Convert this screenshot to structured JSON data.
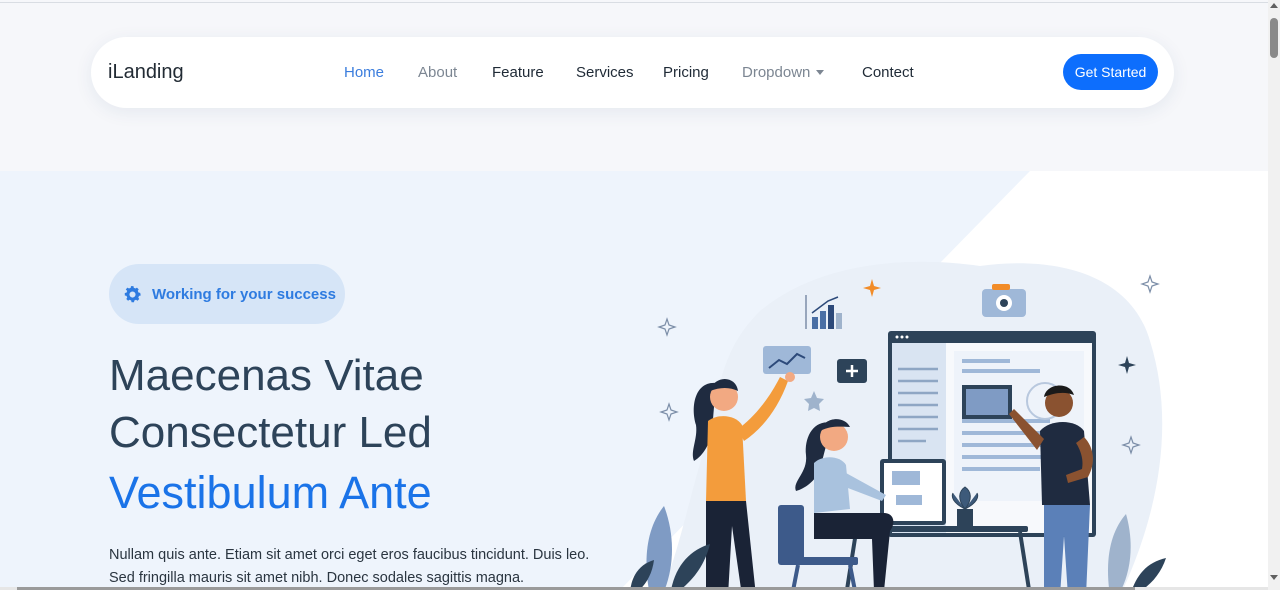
{
  "navbar": {
    "logo": "iLanding",
    "items": [
      {
        "label": "Home",
        "state": "active"
      },
      {
        "label": "About",
        "state": "muted"
      },
      {
        "label": "Feature",
        "state": "normal"
      },
      {
        "label": "Services",
        "state": "normal"
      },
      {
        "label": "Pricing",
        "state": "normal"
      },
      {
        "label": "Dropdown",
        "state": "muted",
        "has_caret": true
      },
      {
        "label": "Contect",
        "state": "normal"
      }
    ],
    "cta_label": "Get Started"
  },
  "hero": {
    "badge_icon": "gear-icon",
    "badge_text": "Working for your success",
    "headline_line1": "Maecenas Vitae",
    "headline_line2": "Consectetur Led",
    "headline_accent": "Vestibulum Ante",
    "lead_line1": "Nullam quis ante. Etiam sit amet orci eget eros faucibus tincidunt. Duis leo.",
    "lead_line2": "Sed fringilla mauris sit amet nibh. Donec sodales sagittis magna."
  },
  "colors": {
    "accent": "#0d6efd",
    "active_nav": "#3b7ddd",
    "hero_bg": "#eef4fc",
    "heading": "#2d4359"
  }
}
